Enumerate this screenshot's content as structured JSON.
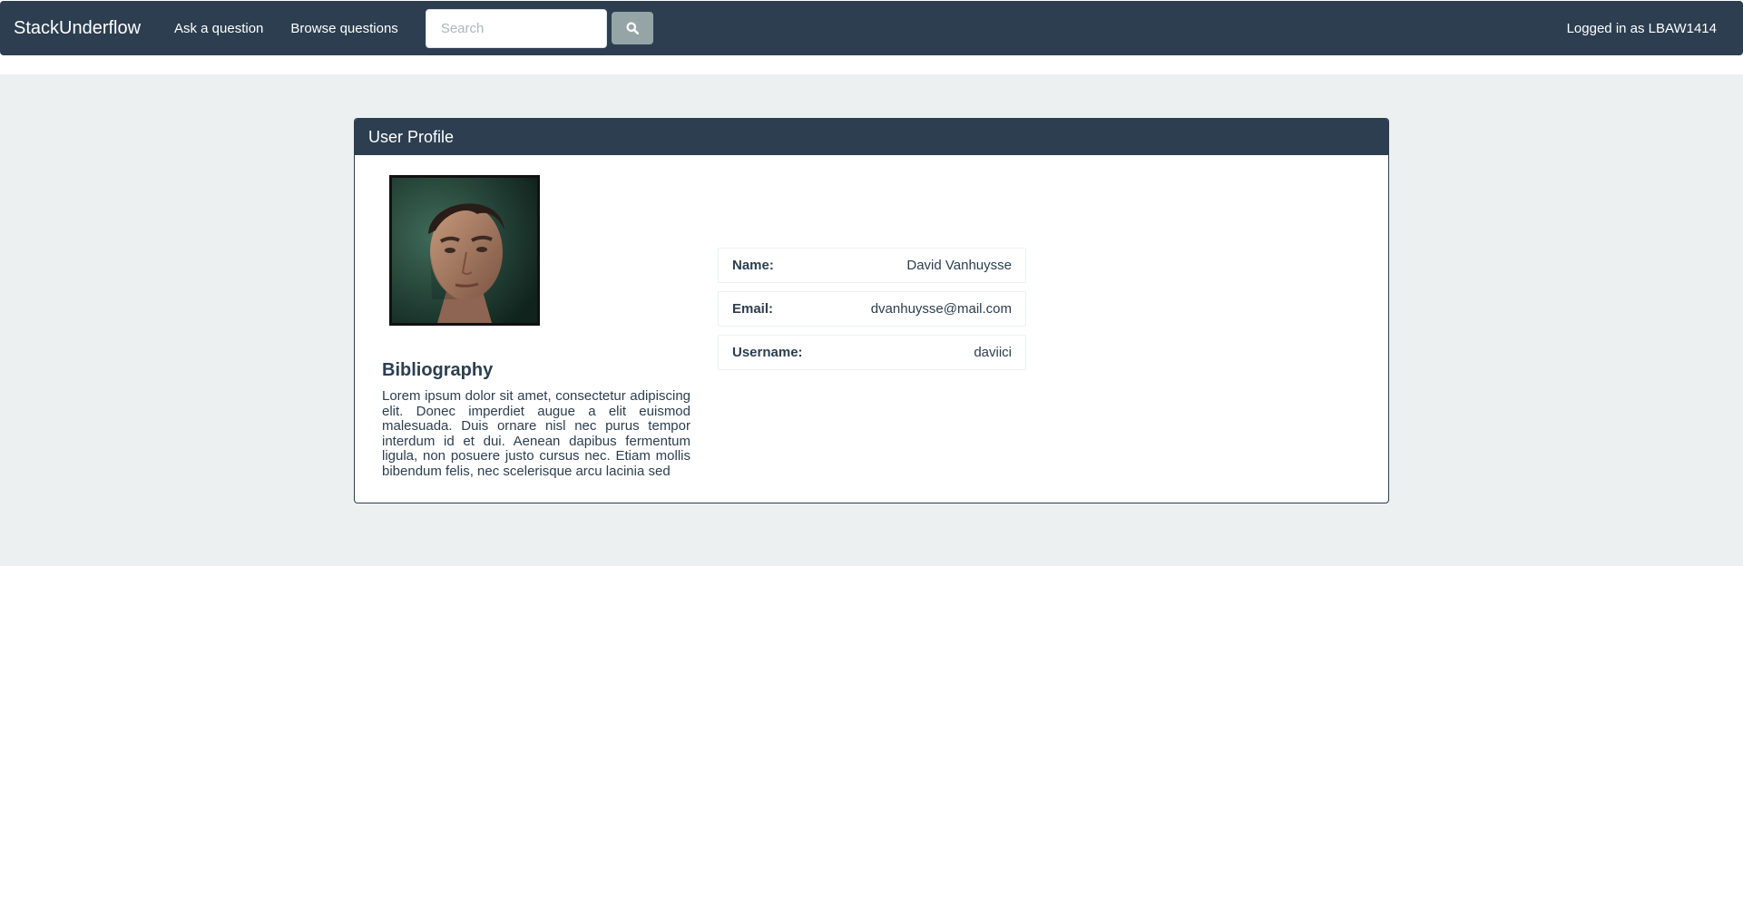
{
  "navbar": {
    "brand": "StackUnderflow",
    "links": [
      "Ask a question",
      "Browse questions"
    ],
    "search_placeholder": "Search",
    "search_icon": "search-icon",
    "logged_in_text": "Logged in as LBAW1414"
  },
  "profile": {
    "panel_title": "User Profile",
    "avatar_icon": "user-avatar-photo",
    "bio_title": "Bibliography",
    "bio_text": "Lorem ipsum dolor sit amet, consectetur adipiscing elit. Donec imperdiet augue a elit euismod malesuada. Duis ornare nisl nec purus tempor interdum id et dui. Aenean dapibus fermentum ligula, non posuere justo cursus nec. Etiam mollis bibendum felis, nec scelerisque arcu lacinia sed",
    "fields": [
      {
        "label": "Name:",
        "value": "David Vanhuysse"
      },
      {
        "label": "Email:",
        "value": "dvanhuysse@mail.com"
      },
      {
        "label": "Username:",
        "value": "daviici"
      }
    ]
  },
  "colors": {
    "navbar": "#2c3e50",
    "jumbotron": "#ecf0f1",
    "search_button": "#95a5a6",
    "text": "#2c3e50"
  }
}
